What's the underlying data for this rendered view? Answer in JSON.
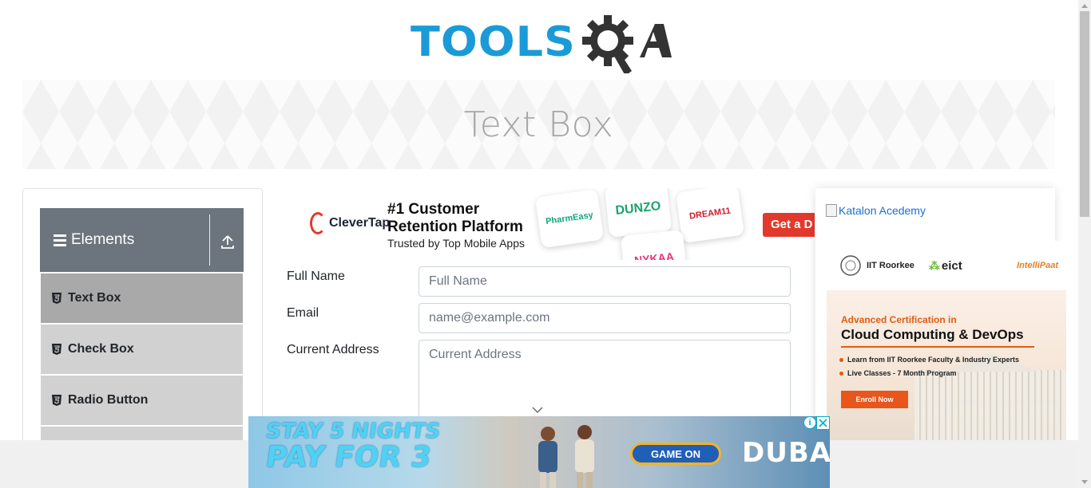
{
  "logo": {
    "text_primary": "TOOLS",
    "text_secondary": "QA",
    "brand_blue": "#1a9bd7",
    "brand_dark": "#333333"
  },
  "banner": {
    "title": "Text Box"
  },
  "sidebar": {
    "group_title": "Elements",
    "items": [
      {
        "label": "Text Box",
        "active": true
      },
      {
        "label": "Check Box",
        "active": false
      },
      {
        "label": "Radio Button",
        "active": false
      }
    ]
  },
  "top_ad": {
    "brand": "CleverTap",
    "headline": "#1 Customer Retention Platform",
    "subline": "Trusted by Top Mobile Apps",
    "apps": [
      "PharmEasy",
      "DUNZO",
      "DREAM11",
      "NYKAA"
    ],
    "cta": "Get a D"
  },
  "form": {
    "full_name": {
      "label": "Full Name",
      "placeholder": "Full Name",
      "value": ""
    },
    "email": {
      "label": "Email",
      "placeholder": "name@example.com",
      "value": ""
    },
    "current_address": {
      "label": "Current Address",
      "placeholder": "Current Address",
      "value": ""
    }
  },
  "right_ad": {
    "broken_image_alt": "Katalon Acedemy",
    "partners": [
      "IIT Roorkee",
      "eict",
      "IntelliPaat"
    ],
    "kicker": "Advanced Certification in",
    "title": "Cloud Computing & DevOps",
    "bullets": [
      "Learn from IIT Roorkee Faculty & Industry Experts",
      "Live Classes - 7 Month Program"
    ],
    "cta": "Enroll Now",
    "accent": "#e05b12"
  },
  "bottom_ad": {
    "line1": "STAY 5 NIGHTS",
    "line2": "PAY FOR 3",
    "button": "GAME ON",
    "brand": "DUBAI",
    "close": "✕",
    "adchoices": "i"
  }
}
